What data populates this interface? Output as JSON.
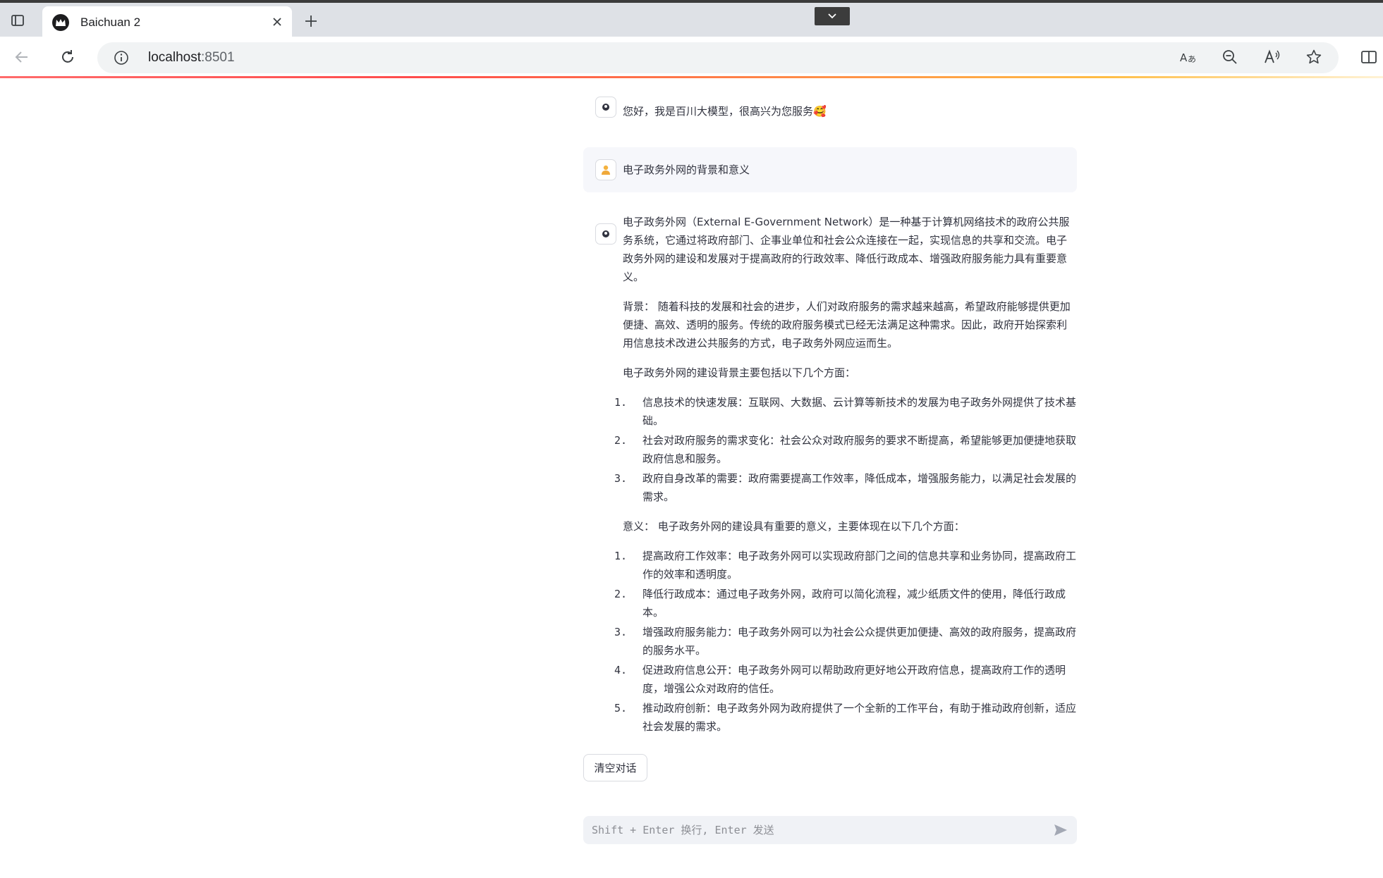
{
  "browser": {
    "tab_title": "Baichuan 2",
    "url_host": "localhost",
    "url_port": ":8501"
  },
  "chat": {
    "greeting": "您好，我是百川大模型，很高兴为您服务🥰",
    "user_message": "电子政务外网的背景和意义",
    "assistant": {
      "intro": "电子政务外网（External E-Government Network）是一种基于计算机网络技术的政府公共服务系统，它通过将政府部门、企事业单位和社会公众连接在一起，实现信息的共享和交流。电子政务外网的建设和发展对于提高政府的行政效率、降低行政成本、增强政府服务能力具有重要意义。",
      "background": "背景： 随着科技的发展和社会的进步，人们对政府服务的需求越来越高，希望政府能够提供更加便捷、高效、透明的服务。传统的政府服务模式已经无法满足这种需求。因此，政府开始探索利用信息技术改进公共服务的方式，电子政务外网应运而生。",
      "bg_heading": "电子政务外网的建设背景主要包括以下几个方面：",
      "bg_items": [
        {
          "num": "1.",
          "text": "信息技术的快速发展：互联网、大数据、云计算等新技术的发展为电子政务外网提供了技术基础。"
        },
        {
          "num": "2.",
          "text": "社会对政府服务的需求变化：社会公众对政府服务的要求不断提高，希望能够更加便捷地获取政府信息和服务。"
        },
        {
          "num": "3.",
          "text": "政府自身改革的需要：政府需要提高工作效率，降低成本，增强服务能力，以满足社会发展的需求。"
        }
      ],
      "significance": "意义： 电子政务外网的建设具有重要的意义，主要体现在以下几个方面：",
      "sig_items": [
        {
          "num": "1.",
          "text": "提高政府工作效率：电子政务外网可以实现政府部门之间的信息共享和业务协同，提高政府工作的效率和透明度。"
        },
        {
          "num": "2.",
          "text": "降低行政成本：通过电子政务外网，政府可以简化流程，减少纸质文件的使用，降低行政成本。"
        },
        {
          "num": "3.",
          "text": "增强政府服务能力：电子政务外网可以为社会公众提供更加便捷、高效的政府服务，提高政府的服务水平。"
        },
        {
          "num": "4.",
          "text": "促进政府信息公开：电子政务外网可以帮助政府更好地公开政府信息，提高政府工作的透明度，增强公众对政府的信任。"
        },
        {
          "num": "5.",
          "text": "推动政府创新：电子政务外网为政府提供了一个全新的工作平台，有助于推动政府创新，适应社会发展的需求。"
        }
      ]
    },
    "clear_button": "清空对话",
    "input_placeholder": "Shift + Enter 换行, Enter 发送"
  }
}
